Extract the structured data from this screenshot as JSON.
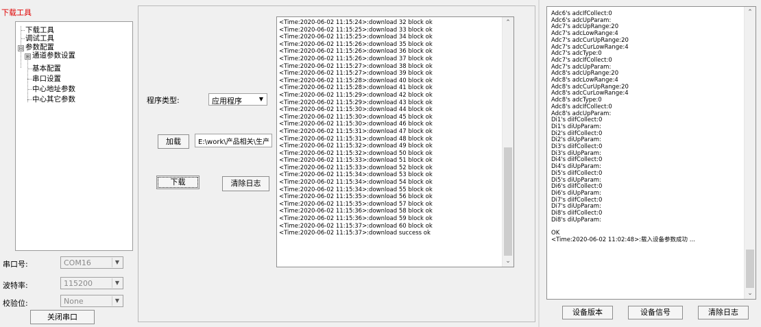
{
  "left": {
    "title": "下载工具",
    "tree": [
      {
        "label": "下载工具"
      },
      {
        "label": "调试工具"
      },
      {
        "label": "参数配置",
        "expander": "⊟"
      },
      {
        "label": "通道参数设置",
        "expander": "⊞"
      },
      {
        "label": "基本配置"
      },
      {
        "label": "串口设置"
      },
      {
        "label": "中心地址参数"
      },
      {
        "label": "中心其它参数"
      }
    ],
    "serial_port_label": "串口号:",
    "serial_port_value": "COM16",
    "baud_label": "波特率:",
    "baud_value": "115200",
    "parity_label": "校验位:",
    "parity_value": "None",
    "close_port_label": "关闭串口"
  },
  "middle": {
    "program_type_label": "程序类型:",
    "program_type_value": "应用程序",
    "load_label": "加载",
    "file_path": "E:\\work\\产品相关\\生产",
    "download_label": "下载",
    "clear_log_label": "清除日志",
    "log_lines": [
      "<Time:2020-06-02 11:15:24>:download 32 block ok",
      "<Time:2020-06-02 11:15:25>:download 33 block ok",
      "<Time:2020-06-02 11:15:25>:download 34 block ok",
      "<Time:2020-06-02 11:15:26>:download 35 block ok",
      "<Time:2020-06-02 11:15:26>:download 36 block ok",
      "<Time:2020-06-02 11:15:26>:download 37 block ok",
      "<Time:2020-06-02 11:15:27>:download 38 block ok",
      "<Time:2020-06-02 11:15:27>:download 39 block ok",
      "<Time:2020-06-02 11:15:28>:download 40 block ok",
      "<Time:2020-06-02 11:15:28>:download 41 block ok",
      "<Time:2020-06-02 11:15:29>:download 42 block ok",
      "<Time:2020-06-02 11:15:29>:download 43 block ok",
      "<Time:2020-06-02 11:15:30>:download 44 block ok",
      "<Time:2020-06-02 11:15:30>:download 45 block ok",
      "<Time:2020-06-02 11:15:30>:download 46 block ok",
      "<Time:2020-06-02 11:15:31>:download 47 block ok",
      "<Time:2020-06-02 11:15:31>:download 48 block ok",
      "<Time:2020-06-02 11:15:32>:download 49 block ok",
      "<Time:2020-06-02 11:15:32>:download 50 block ok",
      "<Time:2020-06-02 11:15:33>:download 51 block ok",
      "<Time:2020-06-02 11:15:33>:download 52 block ok",
      "<Time:2020-06-02 11:15:34>:download 53 block ok",
      "<Time:2020-06-02 11:15:34>:download 54 block ok",
      "<Time:2020-06-02 11:15:34>:download 55 block ok",
      "<Time:2020-06-02 11:15:35>:download 56 block ok",
      "<Time:2020-06-02 11:15:35>:download 57 block ok",
      "<Time:2020-06-02 11:15:36>:download 58 block ok",
      "<Time:2020-06-02 11:15:36>:download 59 block ok",
      "<Time:2020-06-02 11:15:37>:download 60 block ok",
      "<Time:2020-06-02 11:15:37>:download success ok"
    ]
  },
  "right": {
    "log_lines": [
      "Adc6's adcIfCollect:0",
      "Adc6's adcUpParam:",
      "Adc7's adcUpRange:20",
      "Adc7's adcLowRange:4",
      "Adc7's adcCurUpRange:20",
      "Adc7's adcCurLowRange:4",
      "Adc7's adcType:0",
      "Adc7's adcIfCollect:0",
      "Adc7's adcUpParam:",
      "Adc8's adcUpRange:20",
      "Adc8's adcLowRange:4",
      "Adc8's adcCurUpRange:20",
      "Adc8's adcCurLowRange:4",
      "Adc8's adcType:0",
      "Adc8's adcIfCollect:0",
      "Adc8's adcUpParam:",
      "Di1's diIfCollect:0",
      "Di1's diUpParam:",
      "Di2's diIfCollect:0",
      "Di2's diUpParam:",
      "Di3's diIfCollect:0",
      "Di3's diUpParam:",
      "Di4's diIfCollect:0",
      "Di4's diUpParam:",
      "Di5's diIfCollect:0",
      "Di5's diUpParam:",
      "Di6's diIfCollect:0",
      "Di6's diUpParam:",
      "Di7's diIfCollect:0",
      "Di7's diUpParam:",
      "Di8's diIfCollect:0",
      "Di8's diUpParam:",
      "",
      "OK",
      "<Time:2020-06-02 11:02:48>:载入设备参数成功 ..."
    ],
    "device_version_label": "设备版本",
    "device_signal_label": "设备信号",
    "clear_log_label": "清除日志"
  }
}
